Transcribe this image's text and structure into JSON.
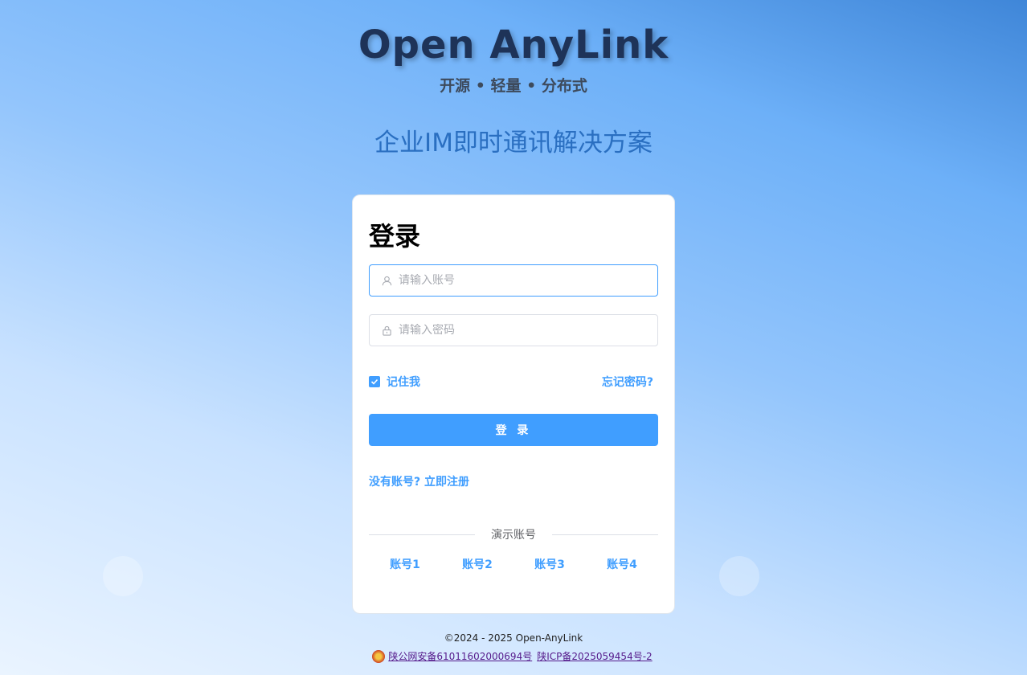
{
  "brand": {
    "title": "Open AnyLink",
    "subtitle": "开源 • 轻量 • 分布式",
    "slogan": "企业IM即时通讯解决方案"
  },
  "login": {
    "title": "登录",
    "account_placeholder": "请输入账号",
    "account_icon": "user-icon",
    "password_placeholder": "请输入密码",
    "password_icon": "lock-icon",
    "remember_label": "记住我",
    "remember_checked": true,
    "forgot_label": "忘记密码?",
    "submit_label": "登 录",
    "register_label": "没有账号? 立即注册",
    "demo_divider": "演示账号",
    "demo_accounts": [
      "账号1",
      "账号2",
      "账号3",
      "账号4"
    ]
  },
  "footer": {
    "copyright": "©2024 - 2025 Open-AnyLink",
    "police_record": "陕公网安备61011602000694号",
    "icp_record": "陕ICP备2025059454号-2"
  },
  "colors": {
    "accent": "#409eff",
    "brand_title": "#1e3358",
    "slogan": "#2a6fc1"
  }
}
